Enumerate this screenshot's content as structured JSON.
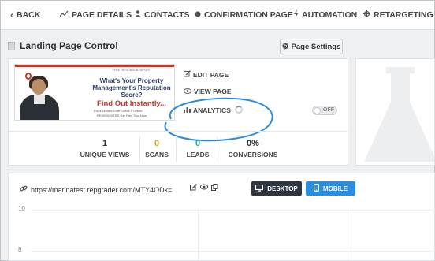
{
  "nav": {
    "back": "BACK",
    "page_details": "PAGE DETAILS",
    "contacts": "CONTACTS",
    "confirmation_page": "CONFIRMATION PAGE",
    "automation": "AUTOMATION",
    "retargeting": "RETARGETING"
  },
  "landing": {
    "title": "Landing Page Control",
    "settings_button": "Page Settings",
    "thumbnail": {
      "top_text": "FREE REPUTATION REPORT",
      "headline": "What's Your Property Management's Reputation Score?",
      "cta": "Find Out Instantly...",
      "small_text": "For a Limited Time Check 3 Online",
      "tiny_text": "REVIEW SITES Get Free Tool Now"
    },
    "actions": {
      "edit": "EDIT PAGE",
      "view": "VIEW PAGE",
      "analytics": "ANALYTICS"
    },
    "toggle_label": "OFF",
    "stats": [
      {
        "value": "1",
        "label": "UNIQUE VIEWS",
        "color": "#333333"
      },
      {
        "value": "0",
        "label": "SCANS",
        "color": "#e8a21a"
      },
      {
        "value": "0",
        "label": "LEADS",
        "color": "#19a89a"
      },
      {
        "value": "0%",
        "label": "CONVERSIONS",
        "color": "#333333"
      }
    ]
  },
  "url_panel": {
    "url": "https://marinatest.repgrader.com/MTY4ODk=",
    "desktop_button": "DESKTOP",
    "mobile_button": "MOBILE",
    "chart_y_labels": [
      "10",
      "8"
    ]
  },
  "colors": {
    "accent_blue": "#2a8de0",
    "dark_button": "#2e3540",
    "annotation_ellipse": "#2a8de0"
  }
}
